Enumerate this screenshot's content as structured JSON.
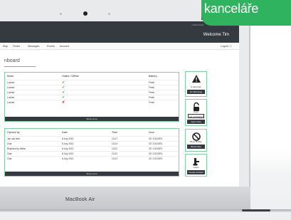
{
  "brand_tag": {
    "text": "kanceláře"
  },
  "laptop": {
    "label": "MacBook Air"
  },
  "header": {
    "language": "LANGUAGE",
    "welcome": "Welcome Tim"
  },
  "nav": {
    "items": [
      "Map",
      "Finder",
      "Messages",
      "Events",
      "Account"
    ],
    "logout": "Logout ⓘ"
  },
  "page": {
    "title": "nboard"
  },
  "locks_panel": {
    "headers": [
      "Mode",
      "Online / Offline",
      "Battery"
    ],
    "rows": [
      {
        "mode": "Locked",
        "online": "✔",
        "battery": "Fresh"
      },
      {
        "mode": "Locked",
        "online": "✔",
        "battery": "Fresh"
      },
      {
        "mode": "Locked",
        "online": "✔",
        "battery": "Fresh"
      },
      {
        "mode": "Locked",
        "online": "✔",
        "battery": "Fresh"
      },
      {
        "mode": "Locked",
        "online": "✘",
        "battery": "Fresh"
      }
    ],
    "footer": "Show more"
  },
  "events_panel": {
    "headers": [
      "Opened by",
      "Date",
      "Time",
      "Door"
    ],
    "rows": [
      {
        "by": "Jan van web",
        "date": "8 July 2013",
        "time": "13:27",
        "door": "CE 3 DOOR1"
      },
      {
        "by": "Clair",
        "date": "8 July 2013",
        "time": "13:24",
        "door": "CE 3 DOOR1"
      },
      {
        "by": "Rejected by offline",
        "date": "8 July 2013",
        "time": "13:22",
        "door": "CE 3 DOOR1"
      },
      {
        "by": "Clair",
        "date": "8 July 2013",
        "time": "13:22",
        "door": "CE 3 DOOR1"
      },
      {
        "by": "Clair",
        "date": "8 July 2013",
        "time": "13:22",
        "door": "CE 3 DOOR1"
      }
    ],
    "footer": "Show more"
  },
  "side": {
    "warnings": {
      "text": "0 warnings",
      "button": "No Warnings"
    },
    "open": {
      "text": "Open",
      "select": "CE 3 DOOR1 ▾",
      "button": "Open Now"
    },
    "block": {
      "text": "Blow Mobile",
      "button": "Block Now"
    },
    "guest": {
      "text": "Guest",
      "button": "Create contract"
    }
  },
  "colors": {
    "accent": "#2fb35f",
    "dark": "#343a40",
    "panel_border": "#7fd0a1"
  }
}
